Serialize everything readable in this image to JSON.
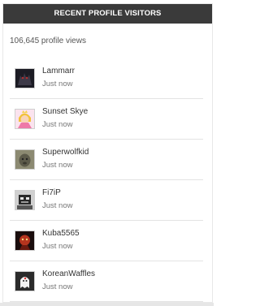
{
  "widget": {
    "title": "RECENT PROFILE VISITORS",
    "profile_views": "106,645 profile views"
  },
  "visitors": [
    {
      "name": "Lammarr",
      "time": "Just now",
      "avatar_icon": "dark-creature-avatar"
    },
    {
      "name": "Sunset Skye",
      "time": "Just now",
      "avatar_icon": "princess-peach-avatar"
    },
    {
      "name": "Superwolfkid",
      "time": "Just now",
      "avatar_icon": "wolf-face-avatar"
    },
    {
      "name": "Fi7iP",
      "time": "Just now",
      "avatar_icon": "robot-avatar"
    },
    {
      "name": "Kuba5565",
      "time": "Just now",
      "avatar_icon": "red-character-avatar"
    },
    {
      "name": "KoreanWaffles",
      "time": "Just now",
      "avatar_icon": "ghost-avatar"
    }
  ],
  "colors": {
    "header_bg": "#3a3a3a",
    "header_text": "#ffffff",
    "divider": "#e3e3e3"
  }
}
